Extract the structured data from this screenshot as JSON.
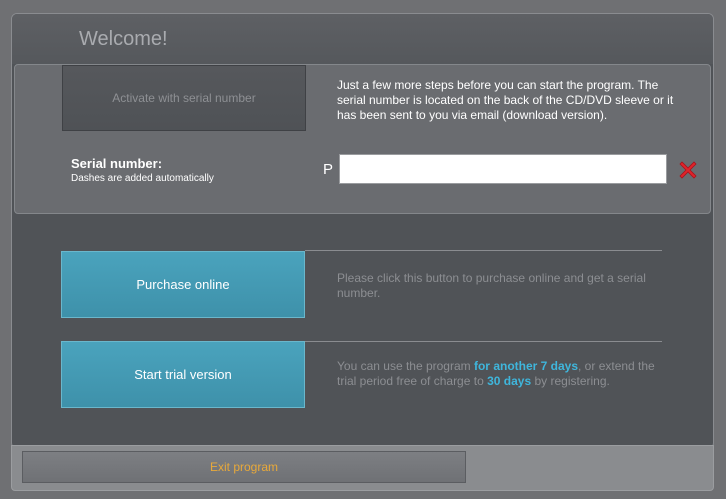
{
  "window": {
    "title": "Welcome!"
  },
  "serial_panel": {
    "activate_label": "Activate with serial number",
    "info_text": "Just a few more steps before you can start the program. The serial number is located on the back of the CD/DVD sleeve or it has been sent to you via email (download version).",
    "serial_label": "Serial number:",
    "serial_hint": "Dashes are added automatically",
    "prefix": "P",
    "input_value": "",
    "clear_icon": "red-x-icon"
  },
  "purchase": {
    "button_label": "Purchase online",
    "description": "Please click this button to purchase online and get a serial number."
  },
  "trial": {
    "button_label": "Start trial version",
    "desc_part1": "You can use the program ",
    "desc_highlight1": "for another 7 days",
    "desc_part2": ", or extend the trial period free of charge to ",
    "desc_highlight2": "30 days",
    "desc_part3": " by registering."
  },
  "footer": {
    "exit_label": "Exit program"
  },
  "colors": {
    "accent_button": "#4aa3bd",
    "highlight_text": "#3fb6dc",
    "exit_text": "#e8a93a",
    "clear_icon": "#e0242b"
  }
}
